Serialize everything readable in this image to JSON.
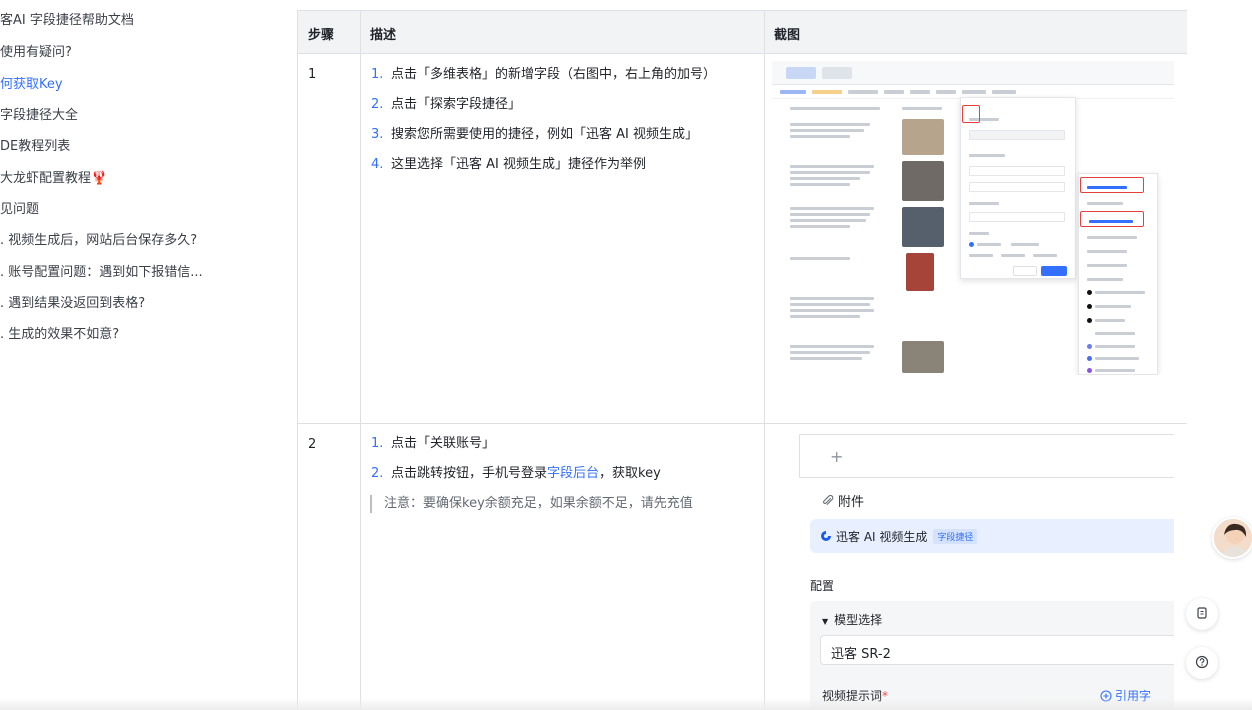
{
  "sidebar": {
    "items": [
      {
        "label": "客AI 字段捷径帮助文档",
        "active": false
      },
      {
        "label": "使用有疑问?",
        "active": false
      },
      {
        "label": "何获取Key",
        "active": true
      },
      {
        "label": "字段捷径大全",
        "active": false
      },
      {
        "label": "DE教程列表",
        "active": false
      },
      {
        "label": "大龙虾配置教程",
        "active": false,
        "emoji": "🦞"
      },
      {
        "label": "见问题",
        "active": false
      },
      {
        "label": ". 视频生成后，网站后台保存多久?",
        "active": false
      },
      {
        "label": ". 账号配置问题：遇到如下报错信...",
        "active": false
      },
      {
        "label": ". 遇到结果没返回到表格?",
        "active": false
      },
      {
        "label": ". 生成的效果不如意?",
        "active": false
      }
    ]
  },
  "table": {
    "headers": {
      "step": "步骤",
      "desc": "描述",
      "shot": "截图"
    },
    "row1": {
      "step": "1",
      "items": [
        {
          "idx": "1.",
          "text": "点击「多维表格」的新增字段（右图中，右上角的加号）"
        },
        {
          "idx": "2.",
          "text": "点击「探索字段捷径」"
        },
        {
          "idx": "3.",
          "text": "搜索您所需要使用的捷径，例如「迅客 AI 视频生成」"
        },
        {
          "idx": "4.",
          "text": "这里选择「迅客 AI 视频生成」捷径作为举例"
        }
      ]
    },
    "row2": {
      "step": "2",
      "item1": {
        "idx": "1.",
        "text": "点击「关联账号」"
      },
      "item2": {
        "idx": "2.",
        "pre": "点击跳转按钮，手机号登录",
        "link": "字段后台",
        "post": "，获取key"
      },
      "note": "注意：要确保key余额充足，如果余额不足，请先充值"
    }
  },
  "screenshot2": {
    "plus": "+",
    "attach": "附件",
    "ai_label": "迅客 AI 视频生成",
    "ai_badge": "字段捷径",
    "config": "配置",
    "model_title": "模型选择",
    "model_value": "迅客 SR-2",
    "prompt_label": "视频提示词",
    "prompt_required": "*",
    "ref_link": "引用字"
  },
  "colors": {
    "accent": "#3370ff",
    "highlight": "#e5413b",
    "header_bg": "#f2f3f5"
  },
  "icons": {
    "attach": "paperclip-icon",
    "ai": "swirl-logo-icon",
    "copy": "copy-icon",
    "help": "help-icon"
  }
}
